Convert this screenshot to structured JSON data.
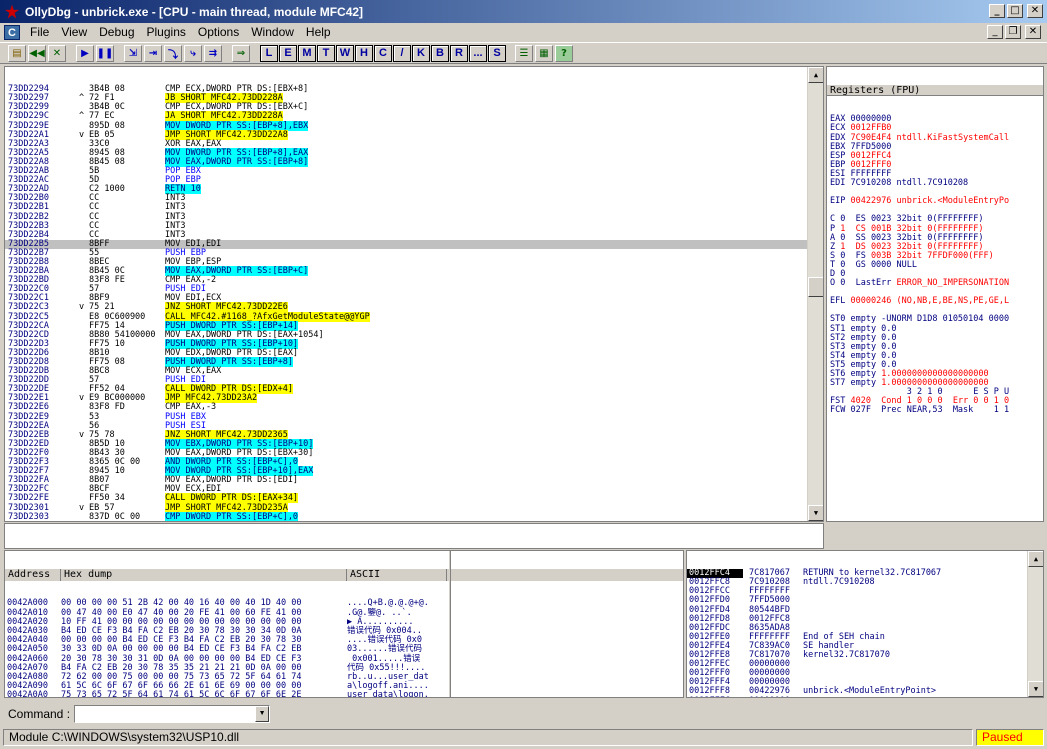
{
  "window": {
    "title": "OllyDbg - unbrick.exe - [CPU - main thread, module MFC42]"
  },
  "menu": [
    "File",
    "View",
    "Debug",
    "Plugins",
    "Options",
    "Window",
    "Help"
  ],
  "toolbar_letters": [
    "L",
    "E",
    "M",
    "T",
    "W",
    "H",
    "C",
    "/",
    "K",
    "B",
    "R",
    "...",
    "S"
  ],
  "cpu_rows": [
    [
      "73DD2294",
      " ",
      "3B4B 08",
      "CMP ECX,DWORD PTR DS:[EBX+8]",
      ""
    ],
    [
      "73DD2297",
      "^",
      "72 F1",
      "JB SHORT MFC42.73DD228A",
      "y"
    ],
    [
      "73DD2299",
      " ",
      "3B4B 0C",
      "CMP ECX,DWORD PTR DS:[EBX+C]",
      ""
    ],
    [
      "73DD229C",
      "^",
      "77 EC",
      "JA SHORT MFC42.73DD228A",
      "y"
    ],
    [
      "73DD229E",
      " ",
      "895D 08",
      "MOV DWORD PTR SS:[EBP+8],EBX",
      "c"
    ],
    [
      "73DD22A1",
      "v",
      "EB 05",
      "JMP SHORT MFC42.73DD22A8",
      "y"
    ],
    [
      "73DD22A3",
      " ",
      "33C0",
      "XOR EAX,EAX",
      ""
    ],
    [
      "73DD22A5",
      " ",
      "8945 08",
      "MOV DWORD PTR SS:[EBP+8],EAX",
      "c"
    ],
    [
      "73DD22A8",
      " ",
      "8B45 08",
      "MOV EAX,DWORD PTR SS:[EBP+8]",
      "c"
    ],
    [
      "73DD22AB",
      " ",
      "5B",
      "POP EBX",
      "b"
    ],
    [
      "73DD22AC",
      " ",
      "5D",
      "POP EBP",
      "b"
    ],
    [
      "73DD22AD",
      " ",
      "C2 1000",
      "RETN 10",
      "c"
    ],
    [
      "73DD22B0",
      " ",
      "CC",
      "INT3",
      ""
    ],
    [
      "73DD22B1",
      " ",
      "CC",
      "INT3",
      ""
    ],
    [
      "73DD22B2",
      " ",
      "CC",
      "INT3",
      ""
    ],
    [
      "73DD22B3",
      " ",
      "CC",
      "INT3",
      ""
    ],
    [
      "73DD22B4",
      " ",
      "CC",
      "INT3",
      ""
    ],
    [
      "73DD22B5",
      " ",
      "8BFF",
      "MOV EDI,EDI",
      "s"
    ],
    [
      "73DD22B7",
      " ",
      "55",
      "PUSH EBP",
      "b"
    ],
    [
      "73DD22B8",
      " ",
      "8BEC",
      "MOV EBP,ESP",
      ""
    ],
    [
      "73DD22BA",
      " ",
      "8B45 0C",
      "MOV EAX,DWORD PTR SS:[EBP+C]",
      "c"
    ],
    [
      "73DD22BD",
      " ",
      "83F8 FE",
      "CMP EAX,-2",
      ""
    ],
    [
      "73DD22C0",
      " ",
      "57",
      "PUSH EDI",
      "b"
    ],
    [
      "73DD22C1",
      " ",
      "8BF9",
      "MOV EDI,ECX",
      ""
    ],
    [
      "73DD22C3",
      "v",
      "75 21",
      "JNZ SHORT MFC42.73DD22E6",
      "y"
    ],
    [
      "73DD22C5",
      " ",
      "E8 0C600900",
      "CALL MFC42.#1168_?AfxGetModuleState@@YGP",
      "y"
    ],
    [
      "73DD22CA",
      " ",
      "FF75 14",
      "PUSH DWORD PTR SS:[EBP+14]",
      "c"
    ],
    [
      "73DD22CD",
      " ",
      "8B80 54100000",
      "MOV EAX,DWORD PTR DS:[EAX+1054]",
      ""
    ],
    [
      "73DD22D3",
      " ",
      "FF75 10",
      "PUSH DWORD PTR SS:[EBP+10]",
      "c"
    ],
    [
      "73DD22D6",
      " ",
      "8B10",
      "MOV EDX,DWORD PTR DS:[EAX]",
      ""
    ],
    [
      "73DD22D8",
      " ",
      "FF75 08",
      "PUSH DWORD PTR SS:[EBP+8]",
      "c"
    ],
    [
      "73DD22DB",
      " ",
      "8BC8",
      "MOV ECX,EAX",
      ""
    ],
    [
      "73DD22DD",
      " ",
      "57",
      "PUSH EDI",
      "b"
    ],
    [
      "73DD22DE",
      " ",
      "FF52 04",
      "CALL DWORD PTR DS:[EDX+4]",
      "y"
    ],
    [
      "73DD22E1",
      "v",
      "E9 BC000000",
      "JMP MFC42.73DD23A2",
      "y"
    ],
    [
      "73DD22E6",
      " ",
      "83F8 FD",
      "CMP EAX,-3",
      ""
    ],
    [
      "73DD22E9",
      " ",
      "53",
      "PUSH EBX",
      "b"
    ],
    [
      "73DD22EA",
      " ",
      "56",
      "PUSH ESI",
      "b"
    ],
    [
      "73DD22EB",
      "v",
      "75 78",
      "JNZ SHORT MFC42.73DD2365",
      "y"
    ],
    [
      "73DD22ED",
      " ",
      "8B5D 10",
      "MOV EBX,DWORD PTR SS:[EBP+10]",
      "c"
    ],
    [
      "73DD22F0",
      " ",
      "8B43 30",
      "MOV EAX,DWORD PTR DS:[EBX+30]",
      ""
    ],
    [
      "73DD22F3",
      " ",
      "8365 0C 00",
      "AND DWORD PTR SS:[EBP+C],0",
      "c"
    ],
    [
      "73DD22F7",
      " ",
      "8945 10",
      "MOV DWORD PTR SS:[EBP+10],EAX",
      "c"
    ],
    [
      "73DD22FA",
      " ",
      "8B07",
      "MOV EAX,DWORD PTR DS:[EDI]",
      ""
    ],
    [
      "73DD22FC",
      " ",
      "8BCF",
      "MOV ECX,EDI",
      ""
    ],
    [
      "73DD22FE",
      " ",
      "FF50 34",
      "CALL DWORD PTR DS:[EAX+34]",
      "y"
    ],
    [
      "73DD2301",
      "v",
      "EB 57",
      "JMP SHORT MFC42.73DD235A",
      "y"
    ],
    [
      "73DD2303",
      " ",
      "837D 0C 00",
      "CMP DWORD PTR SS:[EBP+C],0",
      "c"
    ],
    [
      "73DD2307",
      "v",
      "75 57",
      "JNZ SHORT MFC42.73DD2360",
      "y"
    ],
    [
      "73DD2309",
      " ",
      "8B77 04",
      "MOV ESI,DWORD PTR DS:[EDI+4]",
      ""
    ],
    [
      "73DD230C",
      " ",
      "EB 43",
      "JMP SHORT MFC42.73DD2351",
      "y"
    ]
  ],
  "registers": {
    "title": "Registers (FPU)",
    "lines": [
      [
        "EAX 00000000",
        "",
        ""
      ],
      [
        "ECX ",
        "0012FFB0",
        "r"
      ],
      [
        "EDX ",
        "7C90E4F4 ntdll.KiFastSystemCall",
        "r"
      ],
      [
        "EBX 7FFD5000",
        "",
        ""
      ],
      [
        "ESP ",
        "0012FFC4",
        "r"
      ],
      [
        "EBP ",
        "0012FFF0",
        "r"
      ],
      [
        "ESI FFFFFFFF",
        "",
        ""
      ],
      [
        "EDI 7C910208 ntdll.7C910208",
        "",
        ""
      ],
      [
        "",
        "",
        ""
      ],
      [
        "EIP ",
        "00422976 unbrick.<ModuleEntryPo",
        "r"
      ],
      [
        "",
        "",
        ""
      ],
      [
        "C 0  ES 0023 32bit 0(FFFFFFFF)",
        "",
        ""
      ],
      [
        "P ",
        "1  CS 001B 32bit 0(FFFFFFFF)",
        "r"
      ],
      [
        "A 0  SS 0023 32bit 0(FFFFFFFF)",
        "",
        ""
      ],
      [
        "Z ",
        "1  DS 0023 32bit 0(FFFFFFFF)",
        "r"
      ],
      [
        "S 0  FS ",
        "003B 32bit 7FFDF000(FFF)",
        "r"
      ],
      [
        "T 0  GS 0000 NULL",
        "",
        ""
      ],
      [
        "D 0",
        "",
        ""
      ],
      [
        "O 0  LastErr ",
        "ERROR_NO_IMPERSONATION",
        "r"
      ],
      [
        "",
        "",
        ""
      ],
      [
        "EFL ",
        "00000246 (NO,NB,E,BE,NS,PE,GE,L",
        "r"
      ],
      [
        "",
        "",
        ""
      ],
      [
        "ST0 empty -UNORM D1D8 01050104 0000",
        "",
        ""
      ],
      [
        "ST1 empty 0.0",
        "",
        ""
      ],
      [
        "ST2 empty 0.0",
        "",
        ""
      ],
      [
        "ST3 empty 0.0",
        "",
        ""
      ],
      [
        "ST4 empty 0.0",
        "",
        ""
      ],
      [
        "ST5 empty 0.0",
        "",
        ""
      ],
      [
        "ST6 empty ",
        "1.0000000000000000000",
        "r"
      ],
      [
        "ST7 empty ",
        "1.0000000000000000000",
        "r"
      ],
      [
        "               3 2 1 0      E S P U",
        "",
        ""
      ],
      [
        "FST ",
        "4020  Cond 1 0 0 0  Err 0 0 1 0",
        "r"
      ],
      [
        "FCW 027F  Prec NEAR,53  Mask    1 1",
        "",
        ""
      ]
    ]
  },
  "dump": {
    "headers": [
      "Address",
      "Hex dump",
      "ASCII"
    ],
    "rows": [
      [
        "0042A000",
        "00 00 00 00 51 2B 42 00 40 16 40 00 40 1D 40 00",
        "....Q+B.@.@.@+@."
      ],
      [
        "0042A010",
        "00 47 40 00 E0 47 40 00 20 FE 41 00 60 FE 41 00",
        ".G@.鑒@. ..`."
      ],
      [
        "0042A020",
        "10 FF 41 00 00 00 00 00 00 00 00 00 00 00 00 00",
        "▶ A.........."
      ],
      [
        "0042A030",
        "B4 ED CE F3 B4 FA C2 EB 20 30 78 30 30 34 0D 0A",
        "错误代码 0x004.."
      ],
      [
        "0042A040",
        "00 00 00 00 B4 ED CE F3 B4 FA C2 EB 20 30 78 30",
        "....错误代码 0x0"
      ],
      [
        "0042A050",
        "30 33 0D 0A 00 00 00 00 B4 ED CE F3 B4 FA C2 EB",
        "03......错误代码"
      ],
      [
        "0042A060",
        "20 30 78 30 30 31 0D 0A 00 00 00 00 B4 ED CE F3",
        " 0x001.....错误"
      ],
      [
        "0042A070",
        "B4 FA C2 EB 20 30 78 35 35 21 21 21 0D 0A 00 00",
        "代码 0x55!!!...."
      ],
      [
        "0042A080",
        "72 62 00 00 75 00 00 00 75 73 65 72 5F 64 61 74",
        "rb..u...user_dat"
      ],
      [
        "0042A090",
        "61 5C 6C 6F 67 6F 66 66 2E 61 6E 69 00 00 00 00",
        "a\\logoff.ani...."
      ],
      [
        "0042A0A0",
        "75 73 65 72 5F 64 61 74 61 5C 6C 6F 67 6F 6E 2E",
        "user_data\\logon."
      ],
      [
        "0042A0B0",
        "61 6E 69 00 C9 E8 B1 B8 25 64 3A 20 CF B5 CD B3",
        "ani.设备%d: 系统"
      ],
      [
        "0042A0C0",
        "B3 C9 D5 C2 BC CD EA B3 C9 21 0D 0A 00 00 00 00",
        "储存容量?......"
      ],
      [
        "0042A0D0",
        "C9 E8 B1 B8 25 64 3A 20 D7 C4 D4 B4 C9 D5 C2 B4",
        "设备%d: 驻读去"
      ],
      [
        "0042A0E0",
        "BC CA A7 B0 DC 2C C7 EB BC EC B2 E9 55 53 42 C1",
        "失败? 请检USB"
      ]
    ]
  },
  "stack": {
    "rows": [
      [
        "0012FFC4",
        "7C817067",
        "RETURN to kernel32.7C817067"
      ],
      [
        "0012FFC8",
        "7C910208",
        "ntdll.7C910208"
      ],
      [
        "0012FFCC",
        "FFFFFFFF",
        ""
      ],
      [
        "0012FFD0",
        "7FFD5000",
        ""
      ],
      [
        "0012FFD4",
        "80544BFD",
        ""
      ],
      [
        "0012FFD8",
        "0012FFC8",
        ""
      ],
      [
        "0012FFDC",
        "8635ADA8",
        ""
      ],
      [
        "0012FFE0",
        "FFFFFFFF",
        "End of SEH chain"
      ],
      [
        "0012FFE4",
        "7C839AC0",
        "SE handler"
      ],
      [
        "0012FFE8",
        "7C817070",
        "kernel32.7C817070"
      ],
      [
        "0012FFEC",
        "00000000",
        ""
      ],
      [
        "0012FFF0",
        "00000000",
        ""
      ],
      [
        "0012FFF4",
        "00000000",
        ""
      ],
      [
        "0012FFF8",
        "00422976",
        "unbrick.<ModuleEntryPoint>"
      ],
      [
        "0012FFFC",
        "00000000",
        ""
      ]
    ]
  },
  "command": {
    "label": "Command :"
  },
  "status": {
    "text": "Module C:\\WINDOWS\\system32\\USP10.dll",
    "state": "Paused"
  }
}
